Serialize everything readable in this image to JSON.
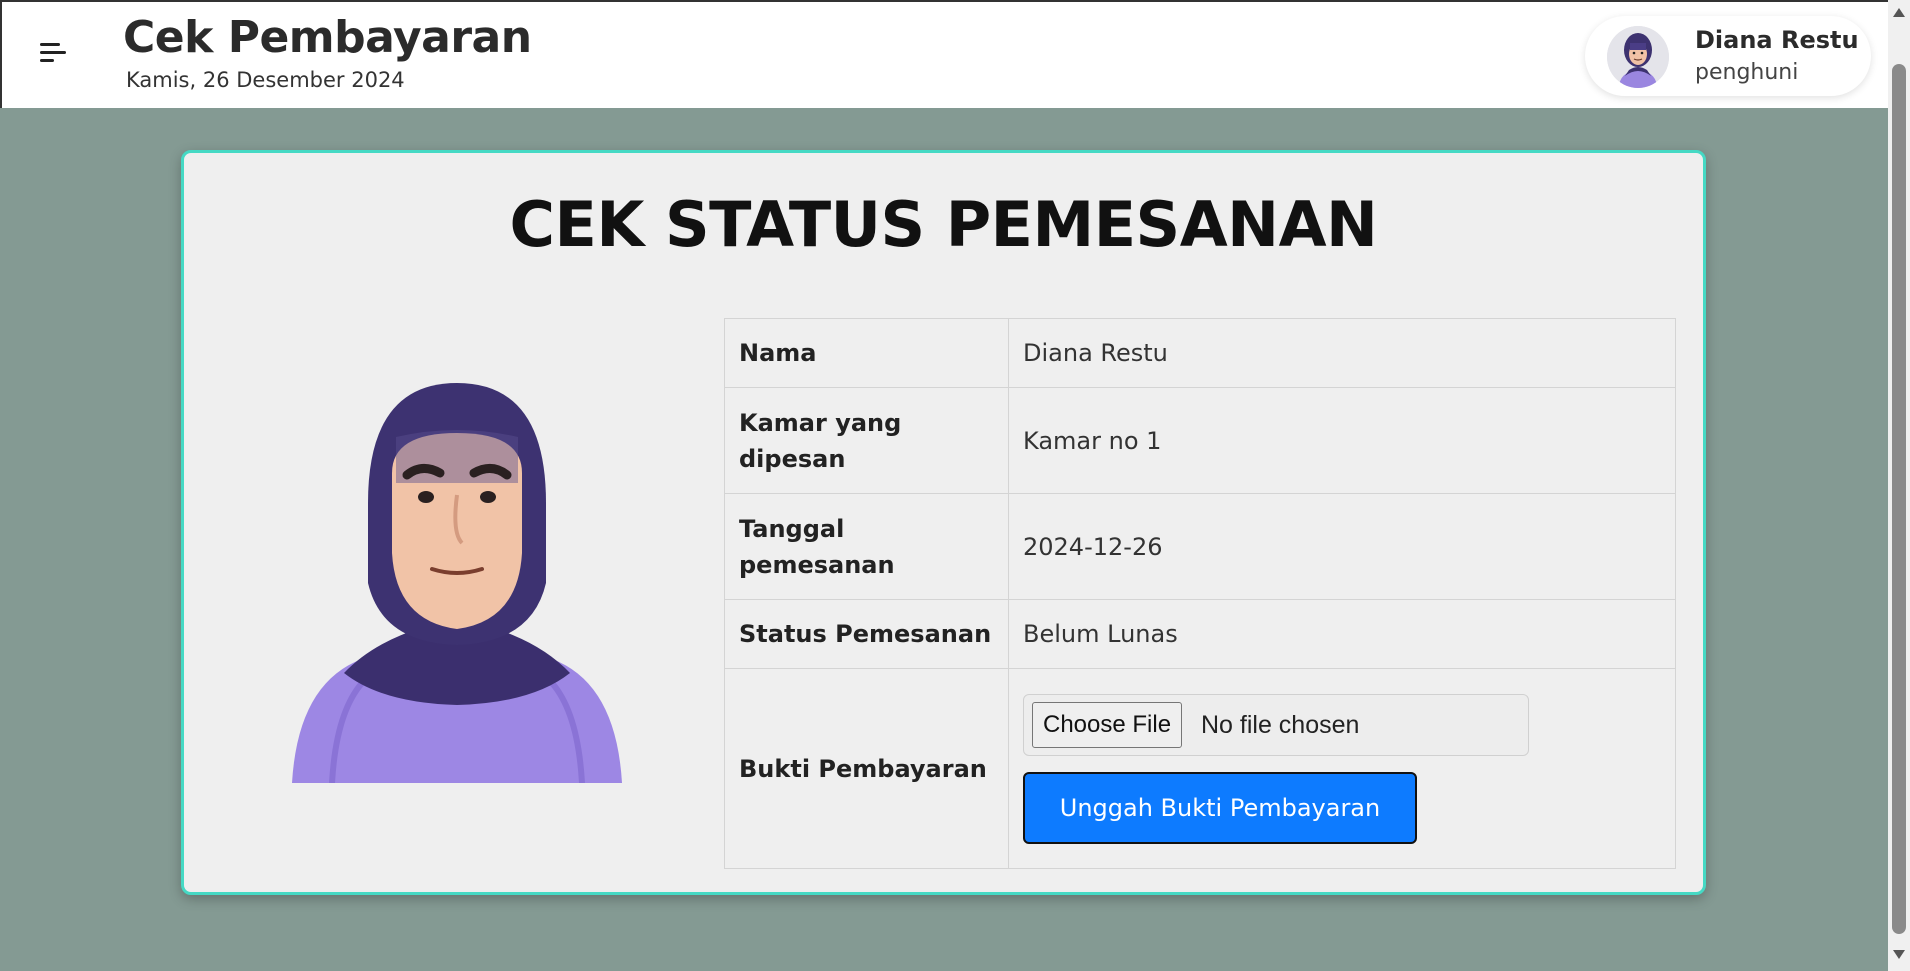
{
  "header": {
    "title": "Cek Pembayaran",
    "date": "Kamis, 26 Desember 2024",
    "user_name": "Diana Restu",
    "user_role": "penghuni"
  },
  "card": {
    "title": "CEK STATUS PEMESANAN",
    "rows": [
      {
        "label": "Nama",
        "value": "Diana Restu"
      },
      {
        "label": "Kamar yang dipesan",
        "value": "Kamar no 1"
      },
      {
        "label": "Tanggal pemesanan",
        "value": "2024-12-26"
      },
      {
        "label": "Status Pemesanan",
        "value": "Belum Lunas"
      }
    ],
    "upload": {
      "label": "Bukti Pembayaran",
      "choose_file_label": "Choose File",
      "file_status": "No file chosen",
      "submit_label": "Unggah Bukti Pembayaran"
    }
  },
  "icons": [
    "menu-icon",
    "user-avatar",
    "person-illustration"
  ],
  "colors": {
    "background": "#849a93",
    "card_border": "#45d9c4",
    "primary_button": "#0d7bff"
  }
}
